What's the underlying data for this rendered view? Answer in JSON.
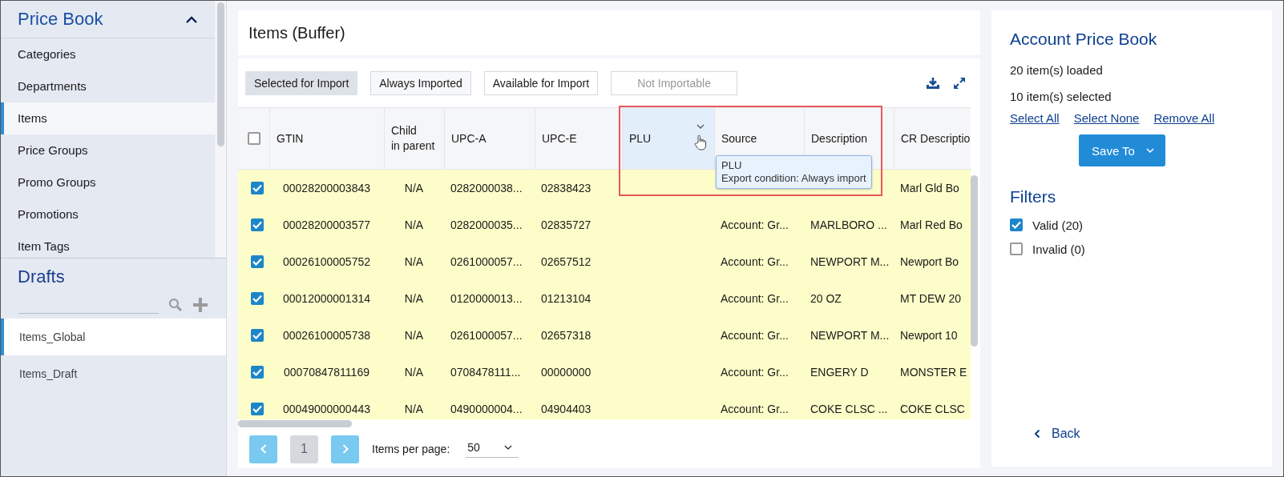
{
  "sidebar": {
    "title": "Price Book",
    "expanded": true,
    "items": [
      {
        "label": "Categories",
        "selected": false
      },
      {
        "label": "Departments",
        "selected": false
      },
      {
        "label": "Items",
        "selected": true
      },
      {
        "label": "Price Groups",
        "selected": false
      },
      {
        "label": "Promo Groups",
        "selected": false
      },
      {
        "label": "Promotions",
        "selected": false
      },
      {
        "label": "Item Tags",
        "selected": false
      }
    ],
    "drafts": {
      "title": "Drafts",
      "items": [
        {
          "label": "Items_Global",
          "selected": true
        },
        {
          "label": "Items_Draft",
          "selected": false
        }
      ]
    }
  },
  "page_title": "Items (Buffer)",
  "filter_tabs": [
    {
      "label": "Selected for Import",
      "selected": true,
      "disabled": false
    },
    {
      "label": "Always Imported",
      "selected": false,
      "disabled": false
    },
    {
      "label": "Available for Import",
      "selected": false,
      "disabled": false
    },
    {
      "label": "Not Importable",
      "selected": false,
      "disabled": true
    }
  ],
  "table": {
    "all_checked": false,
    "columns": [
      {
        "label": "GTIN",
        "hovered": false
      },
      {
        "label": "Child\nin parent",
        "hovered": false
      },
      {
        "label": "UPC-A",
        "hovered": false
      },
      {
        "label": "UPC-E",
        "hovered": false
      },
      {
        "label": "PLU",
        "hovered": true
      },
      {
        "label": "Source",
        "hovered": false
      },
      {
        "label": "Description",
        "hovered": false
      },
      {
        "label": "CR Descriptio",
        "hovered": false
      }
    ],
    "rows": [
      {
        "checked": true,
        "cells": [
          "00028200003843",
          "N/A",
          "0282000038...",
          "02838423",
          null,
          null,
          null,
          "Marl Gld Bo"
        ]
      },
      {
        "checked": true,
        "cells": [
          "00028200003577",
          "N/A",
          "0282000035...",
          "02835727",
          null,
          "Account: Gr...",
          "MARLBORO ...",
          "Marl Red Bo"
        ]
      },
      {
        "checked": true,
        "cells": [
          "00026100005752",
          "N/A",
          "0261000057...",
          "02657512",
          null,
          "Account: Gr...",
          "NEWPORT M...",
          "Newport Bo"
        ]
      },
      {
        "checked": true,
        "cells": [
          "00012000001314",
          "N/A",
          "0120000013...",
          "01213104",
          null,
          "Account: Gr...",
          "20 OZ",
          "MT DEW 20"
        ]
      },
      {
        "checked": true,
        "cells": [
          "00026100005738",
          "N/A",
          "0261000057...",
          "02657318",
          null,
          "Account: Gr...",
          "NEWPORT M...",
          "Newport 10"
        ]
      },
      {
        "checked": true,
        "cells": [
          "00070847811169",
          "N/A",
          "0708478111...",
          "00000000",
          null,
          "Account: Gr...",
          "ENGERY D",
          "MONSTER E"
        ]
      },
      {
        "checked": true,
        "cells": [
          "00049000000443",
          "N/A",
          "0490000004...",
          "04904403",
          null,
          "Account: Gr...",
          "COKE CLSC ...",
          "COKE CLSC"
        ]
      }
    ]
  },
  "tooltip": {
    "title": "PLU",
    "text": "Export condition: Always import"
  },
  "pagination": {
    "page": "1",
    "per_page_label": "Items per page:",
    "per_page": "50"
  },
  "panel": {
    "title": "Account Price Book",
    "loaded": "20 item(s) loaded",
    "selected": "10 item(s) selected",
    "links": [
      "Select All",
      "Select None",
      "Remove All"
    ],
    "save_button": "Save To",
    "filters_title": "Filters",
    "filters": [
      {
        "label": "Valid (20)",
        "checked": true
      },
      {
        "label": "Invalid (0)",
        "checked": false
      }
    ],
    "back": "Back"
  }
}
